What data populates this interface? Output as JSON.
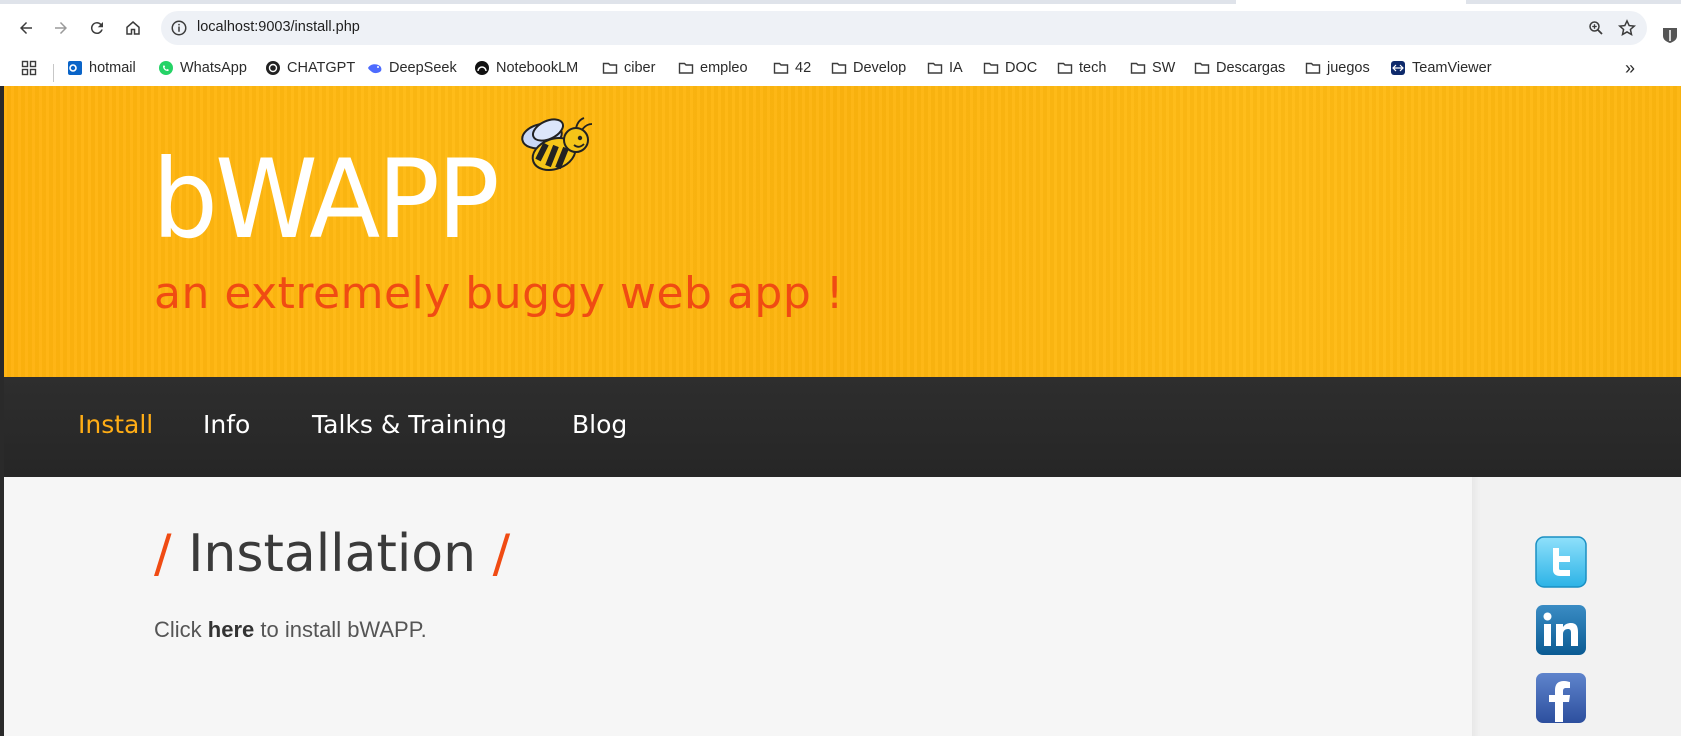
{
  "browser": {
    "url": "localhost:9003/install.php",
    "bookmarks": [
      {
        "label": "hotmail",
        "icon": "outlook-icon"
      },
      {
        "label": "WhatsApp",
        "icon": "whatsapp-icon"
      },
      {
        "label": "CHATGPT",
        "icon": "chatgpt-icon"
      },
      {
        "label": "DeepSeek",
        "icon": "deepseek-icon"
      },
      {
        "label": "NotebookLM",
        "icon": "notebooklm-icon"
      },
      {
        "label": "ciber",
        "icon": "folder-icon"
      },
      {
        "label": "empleo",
        "icon": "folder-icon"
      },
      {
        "label": "42",
        "icon": "folder-icon"
      },
      {
        "label": "Develop",
        "icon": "folder-icon"
      },
      {
        "label": "IA",
        "icon": "folder-icon"
      },
      {
        "label": "DOC",
        "icon": "folder-icon"
      },
      {
        "label": "tech",
        "icon": "folder-icon"
      },
      {
        "label": "SW",
        "icon": "folder-icon"
      },
      {
        "label": "Descargas",
        "icon": "folder-icon"
      },
      {
        "label": "juegos",
        "icon": "folder-icon"
      },
      {
        "label": "TeamViewer",
        "icon": "teamviewer-icon"
      }
    ],
    "overflow_label": "»"
  },
  "site": {
    "logo": "bWAPP",
    "tagline": "an extremely buggy web app !",
    "colors": {
      "header": "#ffb20d",
      "accent": "#f04b13",
      "nav_active": "#ffad15",
      "navbar": "#2b2b2b"
    }
  },
  "nav": {
    "items": [
      {
        "label": "Install",
        "active": true
      },
      {
        "label": "Info",
        "active": false
      },
      {
        "label": "Talks & Training",
        "active": false
      },
      {
        "label": "Blog",
        "active": false
      }
    ]
  },
  "main": {
    "heading_slash_left": "/",
    "heading": "Installation",
    "heading_slash_right": "/",
    "intro_prefix": "Click ",
    "intro_link": "here",
    "intro_suffix": " to install bWAPP."
  },
  "social": [
    {
      "icon": "twitter-icon"
    },
    {
      "icon": "linkedin-icon"
    },
    {
      "icon": "facebook-icon"
    }
  ]
}
